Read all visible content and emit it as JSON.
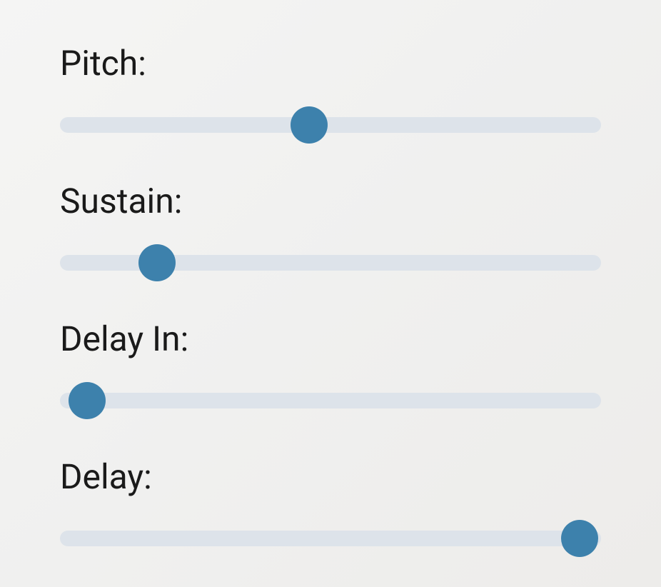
{
  "sliders": {
    "pitch": {
      "label": "Pitch:",
      "value": 46,
      "min": 0,
      "max": 100
    },
    "sustain": {
      "label": "Sustain:",
      "value": 18,
      "min": 0,
      "max": 100
    },
    "delay_in": {
      "label": "Delay In:",
      "value": 5,
      "min": 0,
      "max": 100
    },
    "delay": {
      "label": "Delay:",
      "value": 96,
      "min": 0,
      "max": 100
    }
  },
  "colors": {
    "thumb": "#3d81ac",
    "track": "#dde3ea",
    "text": "#1a1a1a"
  }
}
